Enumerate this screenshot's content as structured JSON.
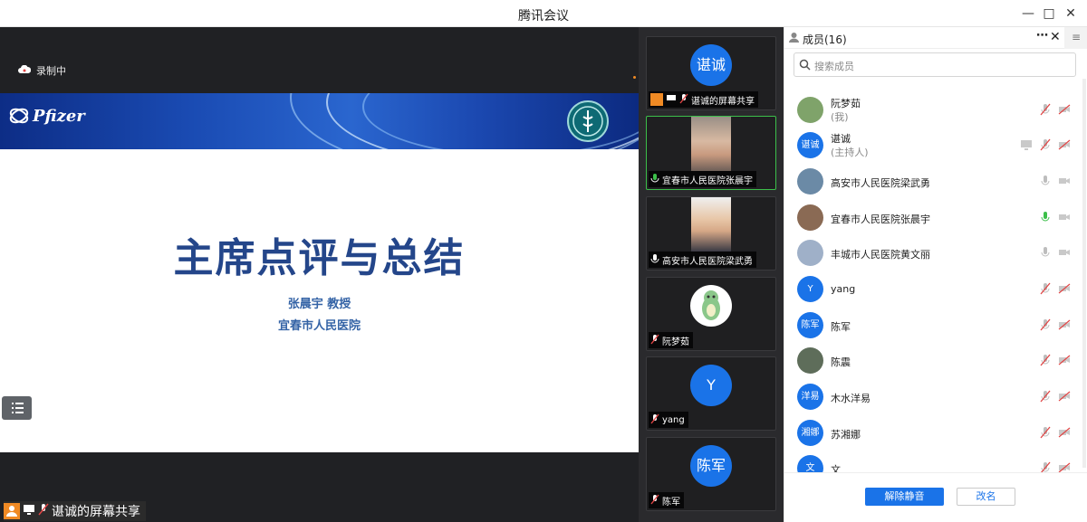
{
  "window": {
    "title": "腾讯会议"
  },
  "main": {
    "recording_label": "录制中",
    "slide": {
      "brand": "Pfizer",
      "title": "主席点评与总结",
      "presenter": "张晨宇 教授",
      "institution": "宜春市人民医院"
    },
    "share_tag": "谌诚的屏幕共享"
  },
  "video_strip": [
    {
      "name": "谌诚的屏幕共享",
      "avatar_text": "谌诚",
      "type": "avatar"
    },
    {
      "name": "宜春市人民医院张晨宇",
      "type": "video",
      "active": true
    },
    {
      "name": "高安市人民医院梁武勇",
      "type": "video"
    },
    {
      "name": "阮梦茹",
      "type": "image"
    },
    {
      "name": "yang",
      "avatar_text": "Y",
      "type": "avatar"
    },
    {
      "name": "陈军",
      "avatar_text": "陈军",
      "type": "avatar"
    }
  ],
  "panel": {
    "title": "成员(16)",
    "search_placeholder": "搜索成员",
    "members": [
      {
        "name": "阮梦茹",
        "sub": "(我)",
        "avatar": "",
        "mic": "muted"
      },
      {
        "name": "谌诚",
        "sub": "(主持人)",
        "avatar": "谌诚",
        "mic": "muted"
      },
      {
        "name": "高安市人民医院梁武勇",
        "sub": "",
        "avatar": "",
        "mic": "off"
      },
      {
        "name": "宜春市人民医院张晨宇",
        "sub": "",
        "avatar": "",
        "mic": "on"
      },
      {
        "name": "丰城市人民医院黄文丽",
        "sub": "",
        "avatar": "",
        "mic": "off"
      },
      {
        "name": "yang",
        "sub": "",
        "avatar": "Y",
        "mic": "muted"
      },
      {
        "name": "陈军",
        "sub": "",
        "avatar": "陈军",
        "mic": "muted"
      },
      {
        "name": "陈震",
        "sub": "",
        "avatar": "",
        "mic": "muted"
      },
      {
        "name": "木水洋易",
        "sub": "",
        "avatar": "洋易",
        "mic": "muted"
      },
      {
        "name": "苏湘娜",
        "sub": "",
        "avatar": "湘娜",
        "mic": "muted"
      },
      {
        "name": "文",
        "sub": "",
        "avatar": "文",
        "mic": "muted"
      }
    ],
    "unmute_all": "解除静音",
    "rename": "改名"
  },
  "colors": {
    "accent": "#1a73e8",
    "active_green": "#3cbf4a",
    "muted_red": "#e04545"
  }
}
